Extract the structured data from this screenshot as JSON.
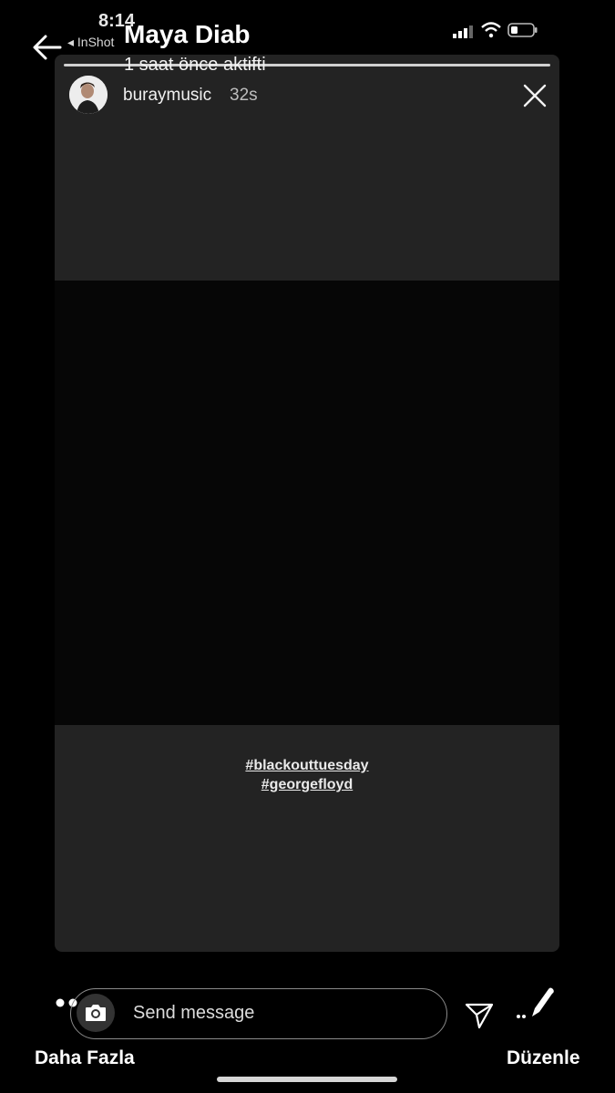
{
  "status_bar": {
    "time": "8:14",
    "back_app": "◂ InShot"
  },
  "header": {
    "contact_name": "Maya Diab",
    "contact_status": "1 saat önce aktifti"
  },
  "story": {
    "username": "buraymusic",
    "time_ago": "32s",
    "hashtags": [
      "#blackouttuesday",
      "#georgefloyd"
    ],
    "progress": 1.0
  },
  "bottom_bar": {
    "message_placeholder": "Send message",
    "more_label": "Daha Fazla",
    "edit_label": "Düzenle"
  },
  "colors": {
    "background": "#000000",
    "card": "#232323",
    "black_block": "#060606"
  }
}
